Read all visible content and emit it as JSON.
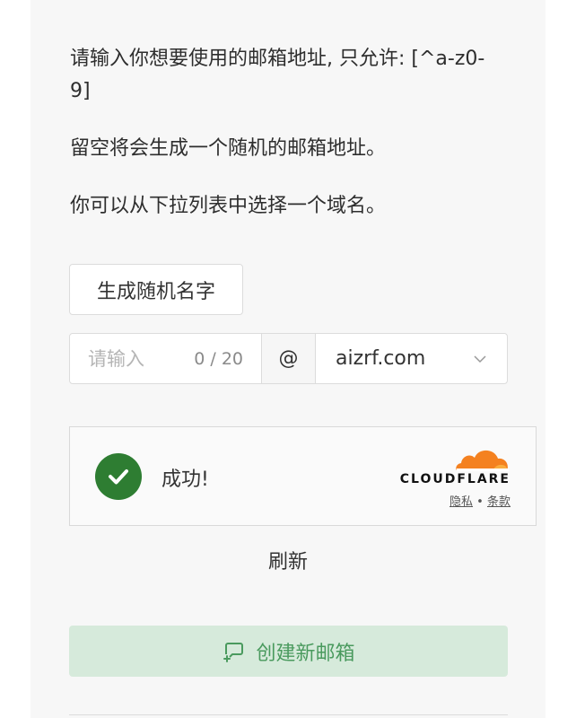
{
  "instructions": {
    "line1": "请输入你想要使用的邮箱地址, 只允许: [^a-z0-9]",
    "line2": "留空将会生成一个随机的邮箱地址。",
    "line3": "你可以从下拉列表中选择一个域名。"
  },
  "generate_button": "生成随机名字",
  "name_input": {
    "placeholder": "请输入",
    "value": "",
    "counter": "0 / 20"
  },
  "at_sign": "@",
  "domain_select": {
    "selected": "aizrf.com"
  },
  "captcha": {
    "status": "成功!",
    "brand": "CLOUDFLARE",
    "privacy": "隐私",
    "separator": "•",
    "terms": "条款",
    "brand_color": "#f48120"
  },
  "refresh_label": "刷新",
  "create_button": "创建新邮箱",
  "colors": {
    "success": "#2e7d32",
    "create_bg": "#d6eadb",
    "create_text": "#4a9a5e"
  }
}
